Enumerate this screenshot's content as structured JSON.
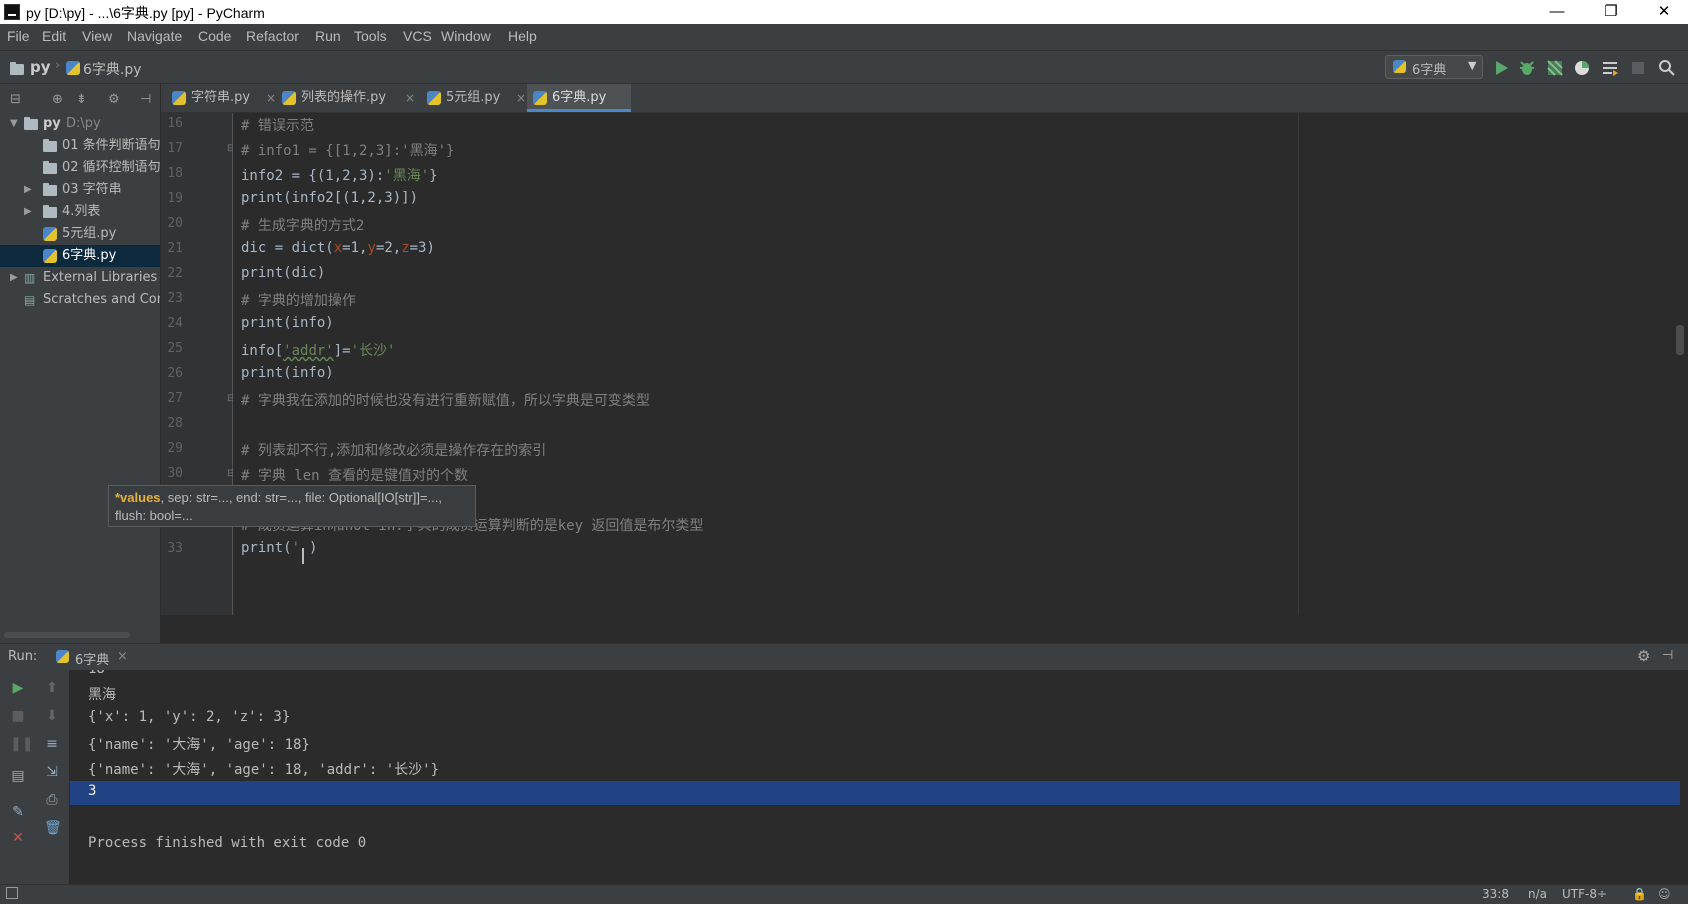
{
  "window": {
    "title": "py [D:\\py] - ...\\6字典.py [py] - PyCharm",
    "controls": {
      "minimize": "—",
      "maximize": "❐",
      "close": "✕"
    }
  },
  "menu": [
    "File",
    "Edit",
    "View",
    "Navigate",
    "Code",
    "Refactor",
    "Run",
    "Tools",
    "VCS",
    "Window",
    "Help"
  ],
  "navbar": {
    "project": "py",
    "file": "6字典.py",
    "run_config": "6字典"
  },
  "project_tree": {
    "root_name": "py",
    "root_path": "D:\\py",
    "items": [
      {
        "label": "01 条件判断语句"
      },
      {
        "label": "02 循环控制语句"
      },
      {
        "label": "03 字符串"
      },
      {
        "label": "4.列表"
      },
      {
        "label": "5元组.py"
      },
      {
        "label": "6字典.py"
      },
      {
        "label": "External Libraries"
      },
      {
        "label": "Scratches and Consoles"
      }
    ]
  },
  "tabs": [
    {
      "label": "字符串.py",
      "close": "×"
    },
    {
      "label": "列表的操作.py",
      "close": "×"
    },
    {
      "label": "5元组.py",
      "close": "×"
    },
    {
      "label": "6字典.py",
      "close": ""
    }
  ],
  "editor": {
    "line_numbers": [
      "16",
      "17",
      "18",
      "19",
      "20",
      "21",
      "22",
      "23",
      "24",
      "25",
      "26",
      "27",
      "28",
      "29",
      "30",
      "31",
      "32",
      "33"
    ],
    "lines": {
      "l16": "# 错误示范",
      "l17": "# info1 = {[1,2,3]:'黑海'}",
      "l18a": "info2 = {(1,2,3):",
      "l18b": "'黑海'",
      "l18c": "}",
      "l19": "print(info2[(1,2,3)])",
      "l20": "# 生成字典的方式2",
      "l21a": "dic = dict(",
      "l21x": "x",
      "l21b": "=1,",
      "l21y": "y",
      "l21c": "=2,",
      "l21z": "z",
      "l21d": "=3)",
      "l22": "print(dic)",
      "l23": "# 字典的增加操作",
      "l24": "print(info)",
      "l25a": "info[",
      "l25b": "'addr'",
      "l25c": "]=",
      "l25d": "'长沙'",
      "l26": "print(info)",
      "l27": "# 字典我在添加的时候也没有进行重新赋值，所以字典是可变类型",
      "l28": "",
      "l29": "# 列表却不行,添加和修改必须是操作存在的索引",
      "l30": "# 字典 len 查看的是键值对的个数",
      "l32": "# 成员运算in和not in:字典的成员运算判断的是key 返回值是布尔类型",
      "l33a": "print(",
      "l33b": "'",
      "l33c": ")"
    },
    "tooltip": {
      "param": "*values",
      "rest1": ", sep: str=..., end: str=..., file: Optional[IO[str]]=...,",
      "rest2": "flush: bool=..."
    }
  },
  "run_panel": {
    "label": "Run:",
    "tab": "6字典",
    "tab_close": "×",
    "output": [
      "18",
      "黑海",
      "{'x': 1, 'y': 2, 'z': 3}",
      "{'name': '大海', 'age': 18}",
      "{'name': '大海', 'age': 18, 'addr': '长沙'}",
      "3",
      "",
      "Process finished with exit code 0"
    ]
  },
  "status": {
    "position": "33:8",
    "line_sep": "n/a",
    "encoding": "UTF-8÷"
  },
  "colors": {
    "background": "#2b2b2b",
    "panel": "#3c3f41",
    "selection": "#214283",
    "comment": "#808080",
    "string": "#6a8759",
    "keyword_arg": "#aa4926"
  }
}
